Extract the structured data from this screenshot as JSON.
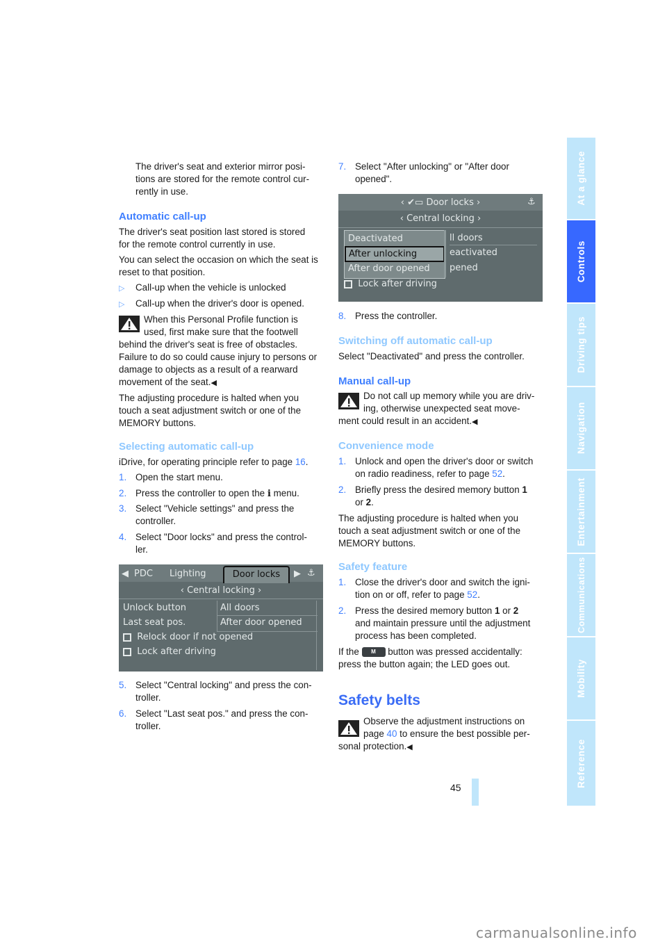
{
  "left_column": {
    "intro": "The driver's seat and exterior mirror positions are stored for the remote control currently in use.",
    "intro_lines": [
      "The driver's seat and exterior mirror posi-",
      "tions are stored for the remote control cur-",
      "rently in use."
    ],
    "automatic_callup": {
      "heading": "Automatic call-up",
      "para1_lines": [
        "The driver's seat position last stored is stored",
        "for the remote control currently in use."
      ],
      "para2_lines": [
        "You can select the occasion on which the seat is",
        "reset to that position."
      ],
      "bullets": [
        "Call-up when the vehicle is unlocked",
        "Call-up when the driver's door is opened."
      ],
      "bullet_marker": "▷",
      "warning_lines": [
        "When this Personal Profile function is",
        "used, first make sure that the footwell",
        "behind the driver's seat is free of obstacles.",
        "Failure to do so could cause injury to persons or",
        "damage to objects as a result of a rearward",
        "movement of the seat."
      ],
      "end_mark": "◀",
      "para3_lines": [
        "The adjusting procedure is halted when you",
        "touch a seat adjustment switch or one of the",
        "MEMORY buttons."
      ]
    },
    "selecting": {
      "heading": "Selecting automatic call-up",
      "intro_text": "iDrive, for operating principle refer to page ",
      "intro_page": "16",
      "intro_end": ".",
      "steps": [
        {
          "num": "1.",
          "lines": [
            "Open the start menu."
          ]
        },
        {
          "num": "2.",
          "lines": [
            "Press the controller to open the ",
            " menu."
          ],
          "icon": "i"
        },
        {
          "num": "3.",
          "lines": [
            "Select \"Vehicle settings\" and press the",
            "controller."
          ]
        },
        {
          "num": "4.",
          "lines": [
            "Select \"Door locks\" and press the control-",
            "ler."
          ]
        },
        {
          "num": "5.",
          "lines": [
            "Select \"Central locking\" and press the con-",
            "troller."
          ]
        },
        {
          "num": "6.",
          "lines": [
            "Select \"Last seat pos.\" and press the con-",
            "troller."
          ]
        }
      ]
    },
    "screen1": {
      "tabs": [
        "PDC",
        "Lighting",
        "Door locks"
      ],
      "active_tab": "Door locks",
      "submenu": "Central locking",
      "rows": [
        {
          "label": "Unlock button",
          "value": "All doors"
        },
        {
          "label": "Last seat pos.",
          "value": "After door opened"
        }
      ],
      "checkboxes": [
        "Relock door if not opened",
        "Lock after driving"
      ]
    }
  },
  "right_column": {
    "step7": {
      "num": "7.",
      "lines": [
        "Select \"After unlocking\" or \"After door",
        "opened\"."
      ]
    },
    "screen2": {
      "title": "Door locks",
      "submenu": "Central locking",
      "popup_options": [
        "Deactivated",
        "After unlocking",
        "After door opened"
      ],
      "selected_option": "After unlocking",
      "behind_values": [
        "ll doors",
        "eactivated",
        "pened"
      ],
      "checkbox": "Lock after driving"
    },
    "step8": {
      "num": "8.",
      "text": "Press the controller."
    },
    "switching_off": {
      "heading": "Switching off automatic call-up",
      "text": "Select \"Deactivated\" and press the controller."
    },
    "manual": {
      "heading": "Manual call-up",
      "warning_lines": [
        "Do not call up memory while you are driv-",
        "ing, otherwise unexpected seat move-",
        "ment could result in an accident."
      ]
    },
    "convenience": {
      "heading": "Convenience mode",
      "step1_lines": [
        "Unlock and open the driver's door or switch",
        "on radio readiness, refer to page "
      ],
      "step1_page": "52",
      "step2_a": "Briefly press the desired memory button ",
      "step2_b1": "1",
      "step2_or": "or ",
      "step2_b2": "2",
      "para_lines": [
        "The adjusting procedure is halted when you",
        "touch a seat adjustment switch or one of the",
        "MEMORY buttons."
      ]
    },
    "safety_feature": {
      "heading": "Safety feature",
      "step1_lines": [
        "Close the driver's door and switch the igni-",
        "tion on or off, refer to page "
      ],
      "step1_page": "52",
      "step2_a": "Press the desired memory button ",
      "step2_b1": "1",
      "step2_or": " or ",
      "step2_b2": "2",
      "step2_lines": [
        "and maintain pressure until the adjustment",
        "process has been completed."
      ],
      "para_pre": "If the ",
      "button_label": "M",
      "para_post": " button was pressed accidentally:",
      "para_line2": "press the button again; the LED goes out."
    },
    "safety_belts": {
      "heading": "Safety belts",
      "warning_line1": "Observe the adjustment instructions on",
      "warning_line2_pre": "page ",
      "warning_page": "40",
      "warning_line2_post": " to ensure the best possible per-",
      "warning_line3": "sonal protection."
    }
  },
  "side_tabs": [
    {
      "label": "At a glance",
      "active": false
    },
    {
      "label": "Controls",
      "active": true
    },
    {
      "label": "Driving tips",
      "active": false
    },
    {
      "label": "Navigation",
      "active": false
    },
    {
      "label": "Entertainment",
      "active": false
    },
    {
      "label": "Communications",
      "active": false
    },
    {
      "label": "Mobility",
      "active": false
    },
    {
      "label": "Reference",
      "active": false
    }
  ],
  "page_number": "45",
  "watermark": "carmanualsonline.info",
  "colors": {
    "accent": "#3f7fff",
    "accent_light": "#8fc8ff",
    "tab_active": "#3768ff",
    "tab_inactive": "#c0e6fb"
  }
}
